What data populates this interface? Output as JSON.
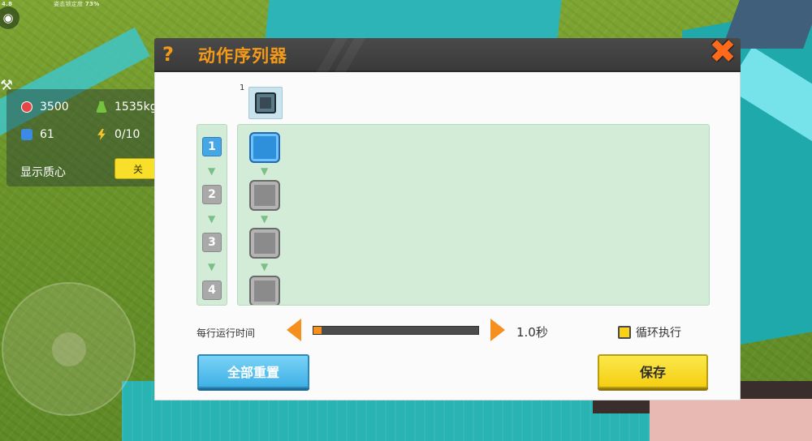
{
  "hud": {
    "status_text": "姿态锁定度",
    "status_percent": "73%",
    "fps_text": "4.8",
    "stats": {
      "health": "3500",
      "mass": "1535kg",
      "blocks": "61",
      "power": "0/10"
    },
    "center_of_mass_label": "显示质心",
    "center_of_mass_toggle": "关"
  },
  "dialog": {
    "title": "动作序列器",
    "slot_number": "1",
    "rows": [
      {
        "number": "1",
        "state": "active"
      },
      {
        "number": "2",
        "state": "inactive"
      },
      {
        "number": "3",
        "state": "inactive"
      },
      {
        "number": "4",
        "state": "inactive"
      }
    ],
    "row_time_label": "每行运行时间",
    "row_time_value": "1.0秒",
    "row_time_fraction": 0.05,
    "loop_label": "循环执行",
    "reset_button": "全部重置",
    "save_button": "保存"
  },
  "colors": {
    "accent_orange": "#f59a18",
    "active_blue": "#2e8fdb",
    "panel_green": "#d3ecd8",
    "save_yellow": "#f5cf12",
    "reset_blue": "#3fb1e6"
  }
}
